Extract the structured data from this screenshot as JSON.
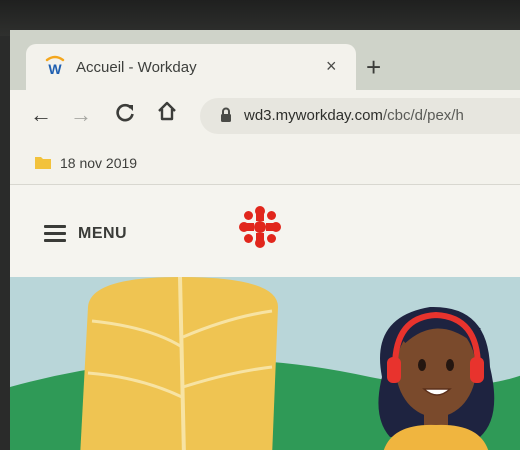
{
  "browser": {
    "tab": {
      "title": "Accueil - Workday",
      "close_glyph": "×",
      "favicon": "workday-logo-icon"
    },
    "new_tab_glyph": "+",
    "toolbar": {
      "back_glyph": "←",
      "forward_glyph": "→",
      "reload_glyph": "C",
      "home_glyph": "⌂"
    },
    "address": {
      "host": "wd3.myworkday.com",
      "path": "/cbc/d/pex/h"
    },
    "bookmarks": [
      {
        "label": "18 nov 2019",
        "icon": "folder-icon"
      }
    ]
  },
  "page": {
    "menu_label": "MENU",
    "logo": "cbc-radio-canada-gem-logo",
    "colors": {
      "logo_red": "#e1261c",
      "leaf_yellow": "#efc452",
      "hill_green": "#2f9a57",
      "sky": "#b9d6d9",
      "headphones_red": "#e8332d"
    }
  }
}
